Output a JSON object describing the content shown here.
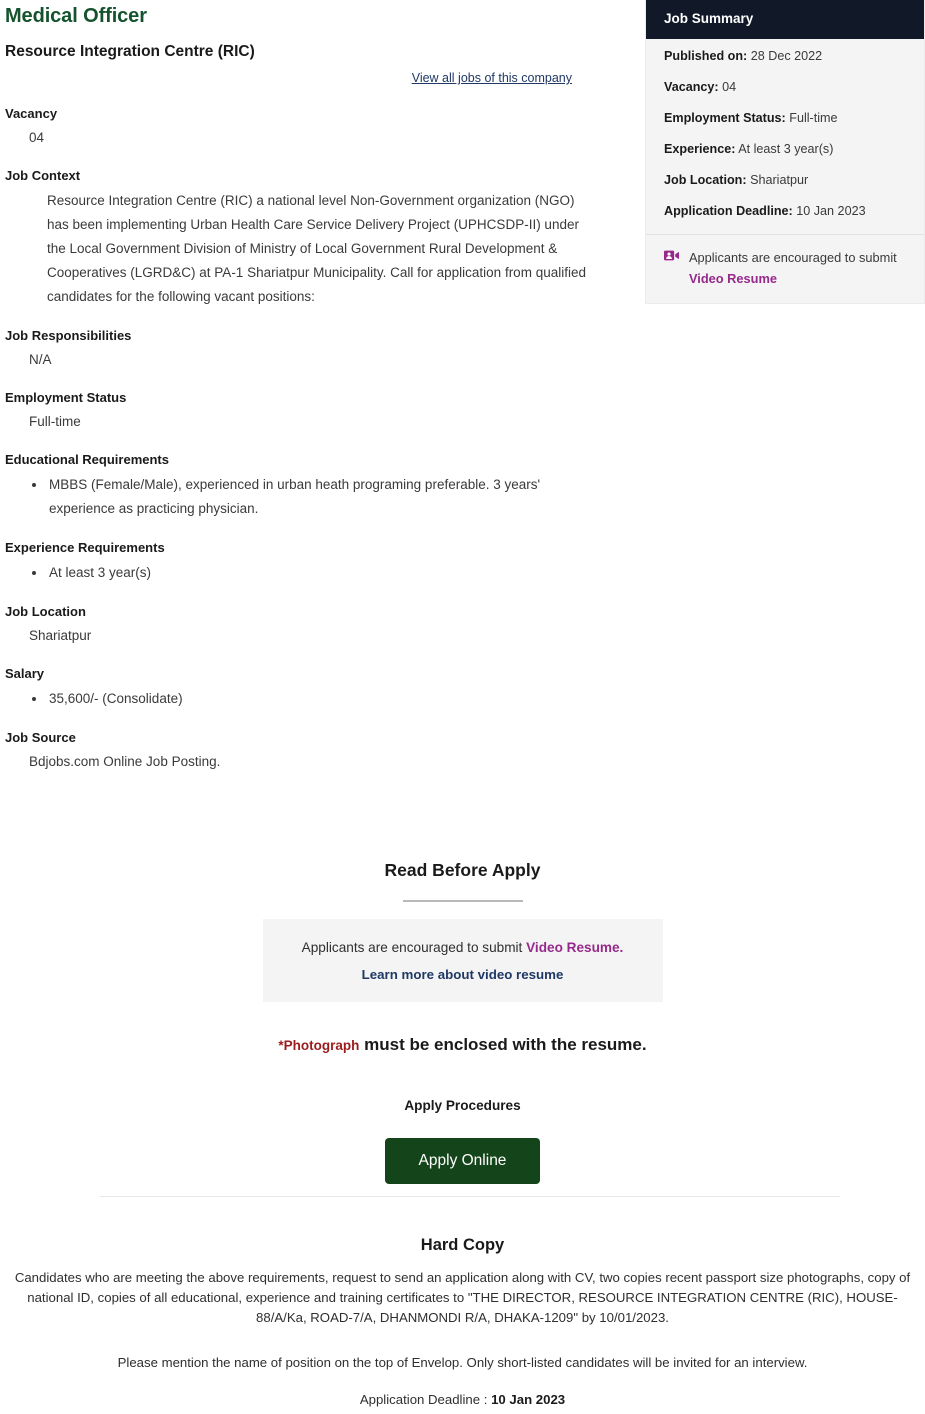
{
  "job": {
    "title": "Medical Officer",
    "company": "Resource Integration Centre (RIC)",
    "view_all_link": "View all jobs of this company",
    "sections": {
      "vacancy_label": "Vacancy",
      "vacancy_value": "04",
      "job_context_label": "Job Context",
      "job_context_value": "Resource Integration Centre (RIC) a national level Non-Government organization (NGO) has been implementing Urban Health Care Service Delivery Project (UPHCSDP-II) under the Local Government Division of Ministry of Local Government Rural Development & Cooperatives (LGRD&C) at PA-1 Shariatpur Municipality. Call for application from qualified candidates for the following vacant positions:",
      "job_responsibilities_label": "Job Responsibilities",
      "job_responsibilities_value": "N/A",
      "employment_status_label": "Employment Status",
      "employment_status_value": "Full-time",
      "educational_requirements_label": "Educational Requirements",
      "educational_requirements_items": [
        "MBBS (Female/Male), experienced in urban heath programing preferable. 3 years' experience as practicing physician."
      ],
      "experience_requirements_label": "Experience Requirements",
      "experience_requirements_items": [
        "At least 3 year(s)"
      ],
      "job_location_label": "Job Location",
      "job_location_value": "Shariatpur",
      "salary_label": "Salary",
      "salary_items": [
        "35,600/- (Consolidate)"
      ],
      "job_source_label": "Job Source",
      "job_source_value": "Bdjobs.com Online Job Posting."
    }
  },
  "summary": {
    "heading": "Job Summary",
    "rows": [
      {
        "label": "Published on:",
        "value": "28 Dec 2022"
      },
      {
        "label": "Vacancy:",
        "value": " 04"
      },
      {
        "label": "Employment Status:",
        "value": "Full-time"
      },
      {
        "label": "Experience:",
        "value": "At least 3 year(s)"
      },
      {
        "label": "Job Location:",
        "value": "Shariatpur"
      },
      {
        "label": "Application Deadline:",
        "value": "10 Jan 2023"
      }
    ],
    "video_icon": "video-resume-icon",
    "video_text_plain": "Applicants are encouraged to submit ",
    "video_text_bold": "Video Resume"
  },
  "read_before_apply": {
    "title": "Read Before Apply",
    "video_box_plain": "Applicants are encouraged to submit ",
    "video_box_bold": "Video Resume.",
    "video_box_link": "Learn more about video resume",
    "photo_required": "*Photograph",
    "photo_rest": " must be enclosed with the resume.",
    "apply_procedures_title": "Apply Procedures",
    "apply_button_label": "Apply Online"
  },
  "hard_copy": {
    "title": "Hard Copy",
    "paragraph": "Candidates who are meeting the above requirements, request to send an application along with CV, two copies recent passport size photographs, copy of national ID, copies of all educational, experience and training certificates to \"THE DIRECTOR, RESOURCE INTEGRATION CENTRE (RIC), HOUSE-88/A/Ka, ROAD-7/A, DHANMONDI R/A, DHAKA-1209\" by 10/01/2023.",
    "paragraph2": "Please mention the name of position on the top of Envelop. Only short-listed candidates will be invited for an interview.",
    "deadline_label": "Application Deadline : ",
    "deadline_value": "10 Jan 2023"
  },
  "colors": {
    "title_green": "#14532d",
    "summary_header_bg": "#111827",
    "accent_purple": "#962a8b",
    "link_navy": "#1f3864",
    "required_red": "#9b1c1c",
    "apply_button_green": "#14441a"
  }
}
